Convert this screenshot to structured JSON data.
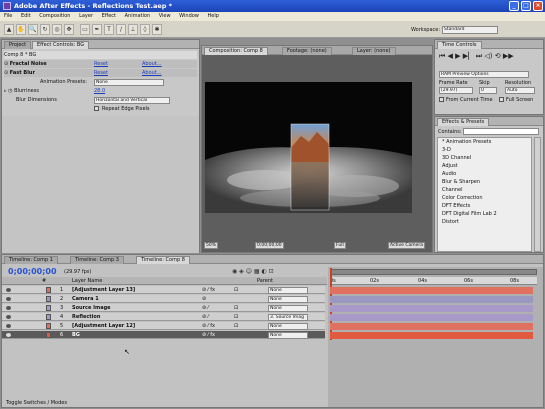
{
  "window": {
    "title": "Adobe After Effects - Reflections Test.aep *"
  },
  "menu": [
    "File",
    "Edit",
    "Composition",
    "Layer",
    "Effect",
    "Animation",
    "View",
    "Window",
    "Help"
  ],
  "workspace": {
    "label": "Workspace:",
    "value": "Standard"
  },
  "project_panel": {
    "tabs": [
      "Project",
      "Effect Controls: BG"
    ],
    "header": "Comp 8 * BG",
    "effects": [
      {
        "name": "Fractal Noise",
        "reset": "Reset",
        "about": "About..."
      },
      {
        "name": "Fast Blur",
        "reset": "Reset",
        "about": "About..."
      }
    ],
    "animation_presets": {
      "label": "Animation Presets:",
      "value": "None"
    },
    "blurriness": {
      "label": "Blurriness",
      "value": "28.0"
    },
    "blur_dimensions": {
      "label": "Blur Dimensions",
      "value": "Horizontal and Vertical"
    },
    "repeat_edge": {
      "label": "Repeat Edge Pixels"
    }
  },
  "comp_panel": {
    "tabs": [
      "Composition: Comp 8",
      "Footage: (none)",
      "Layer: (none)"
    ],
    "controls": [
      "50%",
      "0;00;00;00",
      "Full",
      "Active Camera"
    ]
  },
  "time_controls": {
    "tab": "Time Controls",
    "ram_preview": "RAM Preview Options",
    "frame_rate_label": "Frame Rate",
    "skip_label": "Skip",
    "resolution_label": "Resolution",
    "frame_rate_value": "(29.97)",
    "skip_value": "0",
    "resolution_value": "Auto",
    "from_current": "From Current Time",
    "full_screen": "Full Screen"
  },
  "effects_presets": {
    "tab": "Effects & Presets",
    "contains_label": "Contains:",
    "items": [
      "* Animation Presets",
      "3-D",
      "3D Channel",
      "Adjust",
      "Audio",
      "Blur & Sharpen",
      "Channel",
      "Color Correction",
      "DFT Effects",
      "DFT Digital Film Lab 2",
      "Distort"
    ]
  },
  "timeline": {
    "tabs": [
      "Timeline: Comp 1",
      "Timeline: Comp 3",
      "Timeline: Comp 8"
    ],
    "timecode": "0;00;00;00",
    "fps": "(29.97 fps)",
    "col_num": "#",
    "col_layer": "Layer Name",
    "col_parent": "Parent",
    "ruler": [
      "0s",
      "02s",
      "04s",
      "06s",
      "08s"
    ],
    "layers": [
      {
        "num": "1",
        "name": "[Adjustment Layer 13]",
        "parent": "None",
        "color": "#e07060"
      },
      {
        "num": "2",
        "name": "Camera 1",
        "parent": "None",
        "color": "#9a98c0"
      },
      {
        "num": "3",
        "name": "Source Image",
        "parent": "None",
        "color": "#a899c8"
      },
      {
        "num": "4",
        "name": "Reflection",
        "parent": "3. Source Imag",
        "color": "#a899c8"
      },
      {
        "num": "5",
        "name": "[Adjustment Layer 12]",
        "parent": "None",
        "color": "#e07060"
      },
      {
        "num": "6",
        "name": "BG",
        "parent": "None",
        "color": "#e05a40"
      }
    ],
    "footer": "Toggle Switches / Modes"
  },
  "colors": {
    "accent_blue": "#1a3dba",
    "title_blue": "#1c43b8",
    "timecode": "#2a53d6"
  }
}
